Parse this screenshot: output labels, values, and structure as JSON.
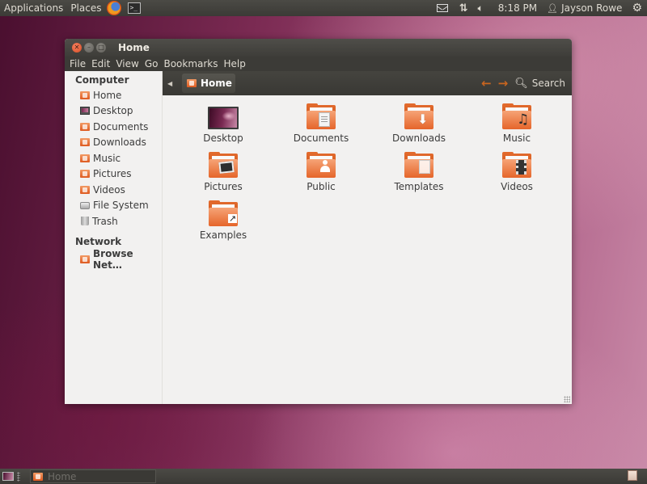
{
  "top_panel": {
    "applications": "Applications",
    "places": "Places",
    "clock": "8:18 PM",
    "user": "Jayson Rowe",
    "icons": [
      "firefox-icon",
      "terminal-icon",
      "mail-icon",
      "network-icon",
      "volume-icon",
      "user-icon",
      "session-gear-icon"
    ]
  },
  "window": {
    "title": "Home",
    "menu": [
      "File",
      "Edit",
      "View",
      "Go",
      "Bookmarks",
      "Help"
    ],
    "breadcrumb": "Home",
    "search_label": "Search"
  },
  "sidebar": {
    "computer_heading": "Computer",
    "computer_items": [
      {
        "label": "Home",
        "icon": "home-folder-icon"
      },
      {
        "label": "Desktop",
        "icon": "desktop-icon"
      },
      {
        "label": "Documents",
        "icon": "documents-folder-icon"
      },
      {
        "label": "Downloads",
        "icon": "downloads-folder-icon"
      },
      {
        "label": "Music",
        "icon": "music-folder-icon"
      },
      {
        "label": "Pictures",
        "icon": "pictures-folder-icon"
      },
      {
        "label": "Videos",
        "icon": "videos-folder-icon"
      },
      {
        "label": "File System",
        "icon": "drive-icon"
      },
      {
        "label": "Trash",
        "icon": "trash-icon"
      }
    ],
    "network_heading": "Network",
    "network_items": [
      {
        "label": "Browse Net…",
        "icon": "network-folder-icon"
      }
    ]
  },
  "files": [
    {
      "label": "Desktop",
      "icon": "desktop-icon"
    },
    {
      "label": "Documents",
      "icon": "documents-folder-icon"
    },
    {
      "label": "Downloads",
      "icon": "downloads-folder-icon"
    },
    {
      "label": "Music",
      "icon": "music-folder-icon"
    },
    {
      "label": "Pictures",
      "icon": "pictures-folder-icon"
    },
    {
      "label": "Public",
      "icon": "public-folder-icon"
    },
    {
      "label": "Templates",
      "icon": "templates-folder-icon"
    },
    {
      "label": "Videos",
      "icon": "videos-folder-icon"
    },
    {
      "label": "Examples",
      "icon": "examples-folder-icon"
    }
  ],
  "bottom_panel": {
    "task_label": "Home"
  },
  "colors": {
    "accent": "#e5652a",
    "panel": "#3c3b37",
    "window_bg": "#f2f1f0"
  }
}
